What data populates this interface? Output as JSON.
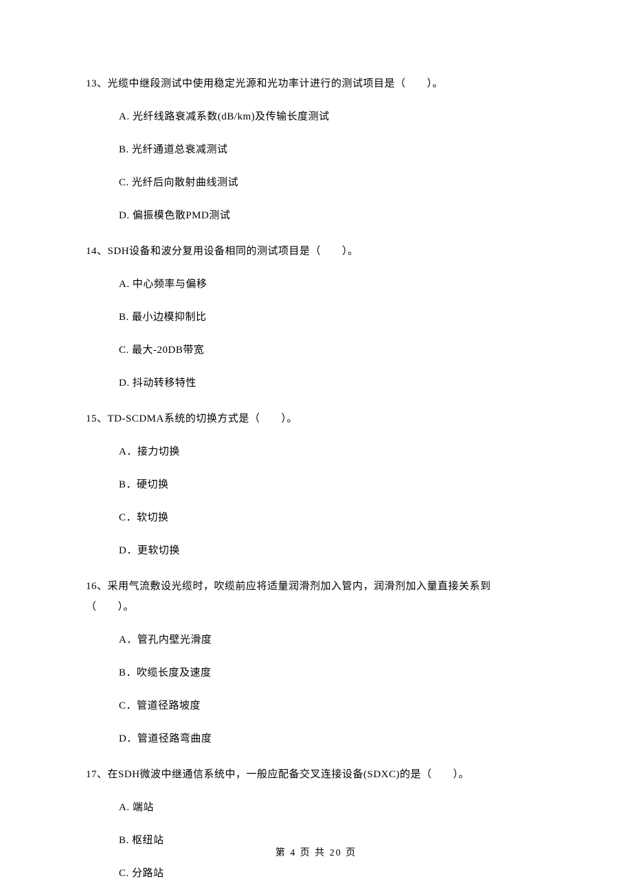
{
  "questions": [
    {
      "num": "13、",
      "text": "光缆中继段测试中使用稳定光源和光功率计进行的测试项目是（　　）。",
      "options": [
        "A.  光纤线路衰减系数(dB/km)及传输长度测试",
        "B.  光纤通道总衰减测试",
        "C.  光纤后向散射曲线测试",
        "D.  偏振模色散PMD测试"
      ]
    },
    {
      "num": "14、",
      "text": "SDH设备和波分复用设备相同的测试项目是（　　）。",
      "options": [
        "A.  中心频率与偏移",
        "B.  最小边模抑制比",
        "C.  最大-20DB带宽",
        "D.  抖动转移特性"
      ]
    },
    {
      "num": "15、",
      "text": "TD-SCDMA系统的切换方式是（　　）。",
      "options": [
        "A．接力切换",
        "B．硬切换",
        "C．软切换",
        "D．更软切换"
      ]
    },
    {
      "num": "16、",
      "text_line1": "采用气流敷设光缆时，吹缆前应将适量润滑剂加入管内，润滑剂加入量直接关系到",
      "text_line2": "（　　）。",
      "options": [
        "A．管孔内壁光滑度",
        "B．吹缆长度及速度",
        "C．管道径路坡度",
        "D．管道径路弯曲度"
      ]
    },
    {
      "num": "17、",
      "text": "在SDH微波中继通信系统中，一般应配备交叉连接设备(SDXC)的是（　　）。",
      "options": [
        "A.  端站",
        "B.  枢纽站",
        "C.  分路站"
      ]
    }
  ],
  "footer": "第 4 页 共 20 页"
}
